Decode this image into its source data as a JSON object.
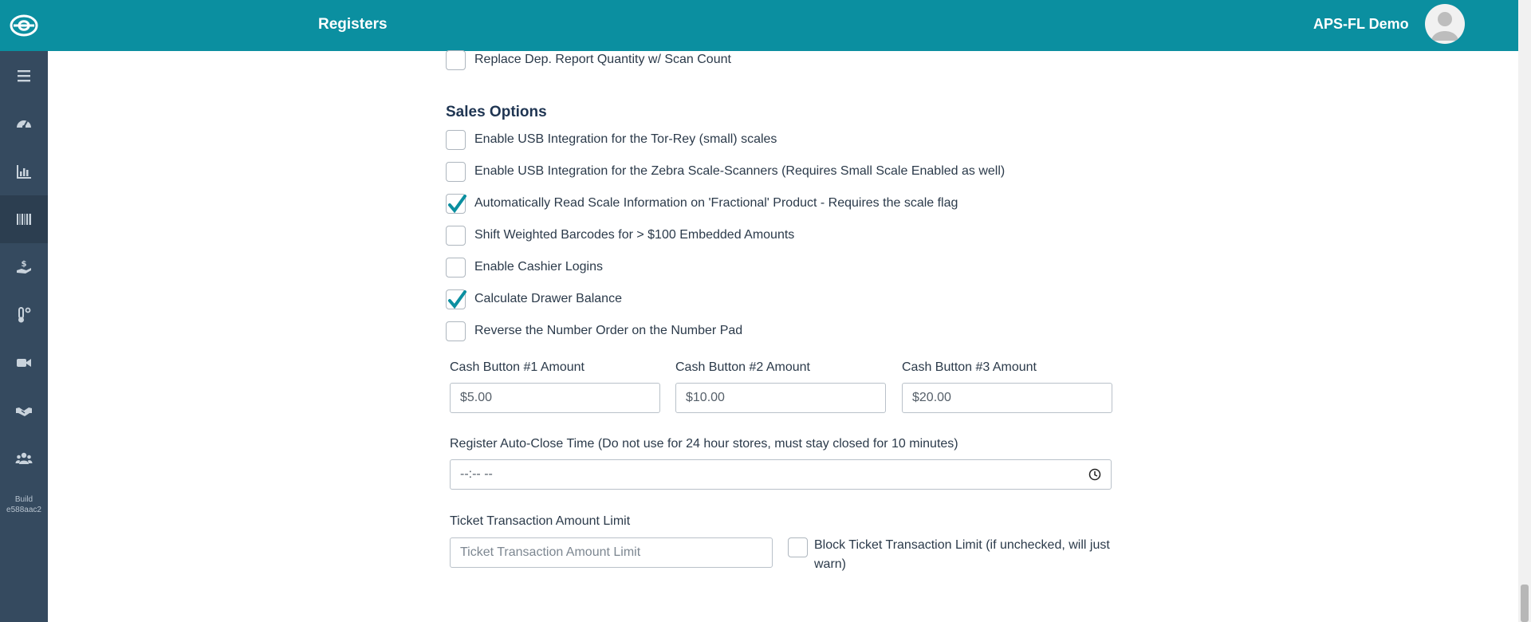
{
  "header": {
    "title": "Registers",
    "user_name": "APS-FL Demo"
  },
  "sidebar": {
    "build_label": "Build",
    "build_id": "e588aac2",
    "items": [
      {
        "icon": "menu-icon"
      },
      {
        "icon": "dashboard-gauge-icon"
      },
      {
        "icon": "bar-chart-icon"
      },
      {
        "icon": "barcode-icon",
        "active": true
      },
      {
        "icon": "hand-money-icon"
      },
      {
        "icon": "thermometer-icon"
      },
      {
        "icon": "video-camera-icon"
      },
      {
        "icon": "handshake-icon"
      },
      {
        "icon": "users-icon"
      }
    ]
  },
  "options": {
    "replace_dep_report": {
      "label": "Replace Dep. Report Quantity w/ Scan Count",
      "checked": false
    },
    "section_title": "Sales Options",
    "items": [
      {
        "label": "Enable USB Integration for the Tor-Rey (small) scales",
        "checked": false
      },
      {
        "label": "Enable USB Integration for the Zebra Scale-Scanners (Requires Small Scale Enabled as well)",
        "checked": false
      },
      {
        "label": "Automatically Read Scale Information on 'Fractional' Product - Requires the scale flag",
        "checked": true
      },
      {
        "label": "Shift Weighted Barcodes for > $100 Embedded Amounts",
        "checked": false
      },
      {
        "label": "Enable Cashier Logins",
        "checked": false
      },
      {
        "label": "Calculate Drawer Balance",
        "checked": true
      },
      {
        "label": "Reverse the Number Order on the Number Pad",
        "checked": false
      }
    ]
  },
  "cash_buttons": [
    {
      "label": "Cash Button #1 Amount",
      "value": "$5.00"
    },
    {
      "label": "Cash Button #2 Amount",
      "value": "$10.00"
    },
    {
      "label": "Cash Button #3 Amount",
      "value": "$20.00"
    }
  ],
  "auto_close": {
    "label": "Register Auto-Close Time (Do not use for 24 hour stores, must stay closed for 10 minutes)",
    "value": "--:-- --"
  },
  "ticket_limit": {
    "label": "Ticket Transaction Amount Limit",
    "placeholder": "Ticket Transaction Amount Limit",
    "value": "",
    "block_label": "Block Ticket Transaction Limit (if unchecked, will just warn)",
    "block_checked": false
  },
  "colors": {
    "header_bg": "#0b8fa0",
    "sidebar_bg": "#354a5f",
    "check_accent": "#0b8fa0"
  }
}
